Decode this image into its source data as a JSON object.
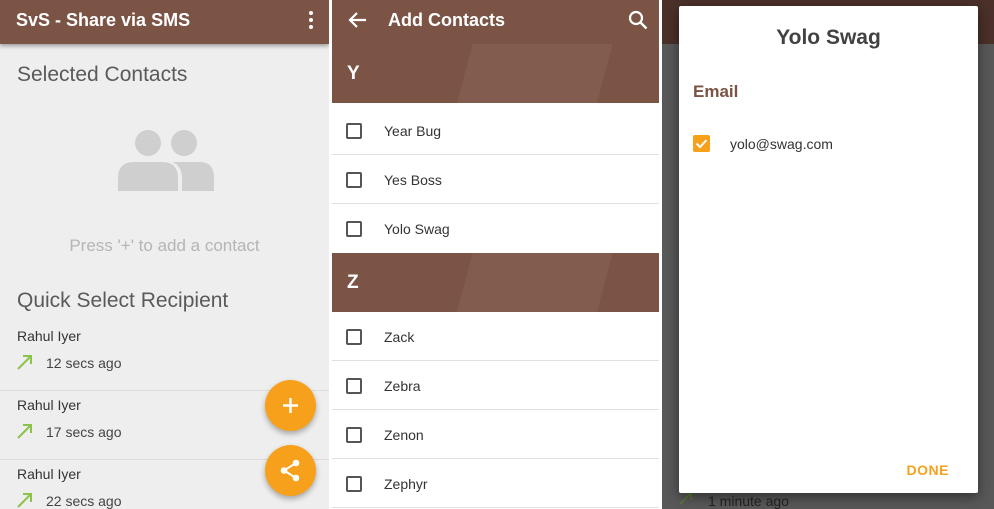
{
  "screen1": {
    "title": "SvS - Share via SMS",
    "selected_heading": "Selected Contacts",
    "empty_hint": "Press '+' to add a contact",
    "quick_heading": "Quick Select Recipient",
    "recipients": [
      {
        "name": "Rahul Iyer",
        "time": "12 secs ago"
      },
      {
        "name": "Rahul Iyer",
        "time": "17 secs ago"
      },
      {
        "name": "Rahul Iyer",
        "time": "22 secs ago"
      }
    ],
    "icons": {
      "menu": "overflow-menu-icon",
      "empty": "people-icon",
      "arrow": "outgoing-arrow-icon",
      "add": "plus-icon",
      "share": "share-icon"
    }
  },
  "screen2": {
    "title": "Add Contacts",
    "groups": [
      {
        "letter": "Y",
        "contacts": [
          "Year Bug",
          "Yes Boss",
          "Yolo Swag"
        ]
      },
      {
        "letter": "Z",
        "contacts": [
          "Zack",
          "Zebra",
          "Zenon",
          "Zephyr"
        ]
      }
    ],
    "icons": {
      "back": "back-arrow-icon",
      "search": "search-icon"
    }
  },
  "screen3": {
    "dialog_title": "Yolo Swag",
    "section": "Email",
    "email": "yolo@swag.com",
    "email_checked": true,
    "done_label": "DONE",
    "background_text": "1 minute ago"
  },
  "colors": {
    "primary": "#7b5446",
    "accent": "#f7a01b",
    "arrow_green": "#8bc34a"
  }
}
